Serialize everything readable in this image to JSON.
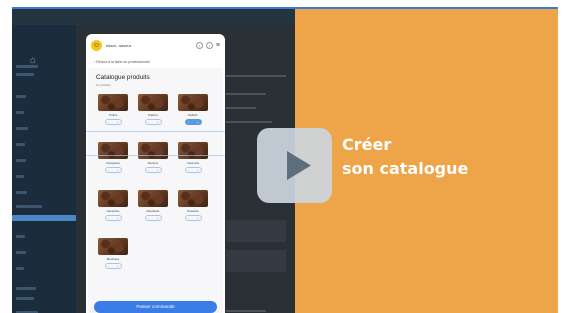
{
  "video": {
    "headline_line1": "Créer",
    "headline_line2": "son catalogue",
    "accent_color": "#eea448",
    "play_icon": "play-icon"
  },
  "phone": {
    "brand": "miam...saveur",
    "back_link": "Retour à la fiche du professionnel",
    "catalog_title": "Catalogue produits",
    "catalog_count": "11 produits",
    "cta_label": "Passer commande",
    "products": [
      {
        "name": "Truffes",
        "selected": false
      },
      {
        "name": "Pralinés",
        "selected": false
      },
      {
        "name": "Ballotin",
        "selected": true
      },
      {
        "name": "Orangettes",
        "selected": false
      },
      {
        "name": "Rochers",
        "selected": false
      },
      {
        "name": "Caramels",
        "selected": false
      },
      {
        "name": "Ganaches",
        "selected": false
      },
      {
        "name": "Mendiants",
        "selected": false
      },
      {
        "name": "Noisettes",
        "selected": false
      },
      {
        "name": "Bouchées",
        "selected": false
      }
    ]
  }
}
